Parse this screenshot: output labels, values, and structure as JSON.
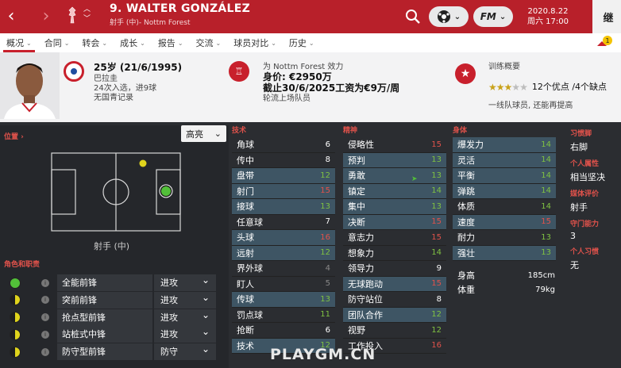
{
  "topbar": {
    "player_name": "9. WALTER GONZÁLEZ",
    "player_subtitle": "射手 (中)- Nottm Forest",
    "date": "2020.8.22",
    "day_time": "周六 17:00",
    "continue_label": "继",
    "fm_label": "FM",
    "icons": [
      "back-arrow-icon",
      "forward-arrow-icon",
      "club-crest-icon",
      "search-icon",
      "ball-icon",
      "fm-menu-icon"
    ]
  },
  "tabs": [
    {
      "label": "概况",
      "active": true
    },
    {
      "label": "合同"
    },
    {
      "label": "转会"
    },
    {
      "label": "成长"
    },
    {
      "label": "报告"
    },
    {
      "label": "交流"
    },
    {
      "label": "球员对比"
    },
    {
      "label": "历史"
    }
  ],
  "alert_count": "1",
  "header": {
    "age": "25岁 (21/6/1995)",
    "nation": "巴拉圭",
    "caps": "24次入选，进9球",
    "youth": "无国青记录",
    "club_line": "为 Nottm Forest 效力",
    "value": "身价: €2950万",
    "contract": "截止30/6/2025工资为€9万/周",
    "squad_status": "轮流上场队员",
    "training_title": "训练概要",
    "stars_filled": 3,
    "stars_total": 5,
    "pros_cons": "12个优点 /4个缺点",
    "training_note": "一线队球员, 还能再提高"
  },
  "field": {
    "position_label": "位置 ›",
    "highlight_dropdown": "高亮",
    "position_name": "射手 (中)"
  },
  "roles": {
    "title": "角色和职责",
    "items": [
      {
        "name": "全能前锋",
        "duty": "进攻",
        "dot": "green"
      },
      {
        "name": "突前前锋",
        "duty": "进攻",
        "dot": "half"
      },
      {
        "name": "抢点型前锋",
        "duty": "进攻",
        "dot": "half"
      },
      {
        "name": "站桩式中锋",
        "duty": "进攻",
        "dot": "half"
      },
      {
        "name": "防守型前锋",
        "duty": "防守",
        "dot": "half"
      }
    ]
  },
  "attributes": {
    "technical": {
      "title": "技术",
      "items": [
        {
          "name": "角球",
          "value": "6",
          "hl": false,
          "color": "#ffffff"
        },
        {
          "name": "传中",
          "value": "8",
          "hl": false,
          "color": "#ffffff"
        },
        {
          "name": "盘带",
          "value": "12",
          "hl": true,
          "color": "#7fc142"
        },
        {
          "name": "射门",
          "value": "15",
          "hl": true,
          "color": "#e0524b"
        },
        {
          "name": "接球",
          "value": "13",
          "hl": true,
          "color": "#7fc142"
        },
        {
          "name": "任意球",
          "value": "7",
          "hl": false,
          "color": "#ffffff"
        },
        {
          "name": "头球",
          "value": "16",
          "hl": true,
          "color": "#e0524b"
        },
        {
          "name": "远射",
          "value": "12",
          "hl": true,
          "color": "#7fc142"
        },
        {
          "name": "界外球",
          "value": "4",
          "hl": false,
          "color": "#888888"
        },
        {
          "name": "盯人",
          "value": "5",
          "hl": false,
          "color": "#888888"
        },
        {
          "name": "传球",
          "value": "13",
          "hl": true,
          "color": "#7fc142"
        },
        {
          "name": "罚点球",
          "value": "11",
          "hl": false,
          "color": "#7fc142"
        },
        {
          "name": "抢断",
          "value": "6",
          "hl": false,
          "color": "#ffffff"
        },
        {
          "name": "技术",
          "value": "12",
          "hl": true,
          "color": "#7fc142"
        }
      ]
    },
    "mental": {
      "title": "精神",
      "items": [
        {
          "name": "侵略性",
          "value": "15",
          "hl": false,
          "color": "#e0524b"
        },
        {
          "name": "预判",
          "value": "13",
          "hl": true,
          "color": "#7fc142"
        },
        {
          "name": "勇敢",
          "value": "13",
          "hl": true,
          "color": "#7fc142"
        },
        {
          "name": "镇定",
          "value": "14",
          "hl": true,
          "color": "#7fc142"
        },
        {
          "name": "集中",
          "value": "13",
          "hl": true,
          "color": "#7fc142"
        },
        {
          "name": "决断",
          "value": "15",
          "hl": true,
          "color": "#e0524b"
        },
        {
          "name": "意志力",
          "value": "15",
          "hl": false,
          "color": "#e0524b"
        },
        {
          "name": "想象力",
          "value": "14",
          "hl": false,
          "color": "#7fc142"
        },
        {
          "name": "领导力",
          "value": "9",
          "hl": false,
          "color": "#ffffff"
        },
        {
          "name": "无球跑动",
          "value": "15",
          "hl": true,
          "color": "#e0524b"
        },
        {
          "name": "防守站位",
          "value": "8",
          "hl": false,
          "color": "#ffffff"
        },
        {
          "name": "团队合作",
          "value": "12",
          "hl": true,
          "color": "#7fc142"
        },
        {
          "name": "视野",
          "value": "12",
          "hl": false,
          "color": "#7fc142"
        },
        {
          "name": "工作投入",
          "value": "16",
          "hl": false,
          "color": "#e0524b"
        }
      ]
    },
    "physical": {
      "title": "身体",
      "items": [
        {
          "name": "爆发力",
          "value": "14",
          "hl": true,
          "color": "#7fc142"
        },
        {
          "name": "灵活",
          "value": "14",
          "hl": true,
          "color": "#7fc142"
        },
        {
          "name": "平衡",
          "value": "14",
          "hl": true,
          "color": "#7fc142"
        },
        {
          "name": "弹跳",
          "value": "14",
          "hl": true,
          "color": "#7fc142"
        },
        {
          "name": "体质",
          "value": "14",
          "hl": false,
          "color": "#7fc142"
        },
        {
          "name": "速度",
          "value": "15",
          "hl": true,
          "color": "#e0524b"
        },
        {
          "name": "耐力",
          "value": "13",
          "hl": false,
          "color": "#7fc142"
        },
        {
          "name": "强壮",
          "value": "13",
          "hl": true,
          "color": "#7fc142"
        }
      ]
    },
    "height_label": "身高",
    "height": "185cm",
    "weight_label": "体重",
    "weight": "79kg"
  },
  "side_info": [
    {
      "label": "习惯脚",
      "value": "右脚"
    },
    {
      "label": "个人属性",
      "value": "相当坚决"
    },
    {
      "label": "媒体评价",
      "value": "射手"
    },
    {
      "label": "守门能力",
      "value": "3"
    },
    {
      "label": "个人习惯",
      "value": "无"
    }
  ],
  "watermark": "PLAYGM.CN"
}
